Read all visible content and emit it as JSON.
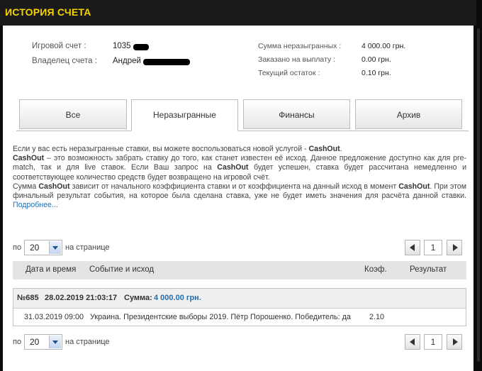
{
  "title": "ИСТОРИЯ СЧЕТА",
  "account": {
    "account_label": "Игровой счет :",
    "account_value": "1035",
    "owner_label": "Владелец счета :",
    "owner_value": "Андрей"
  },
  "summary": {
    "unplayed_label": "Сумма неразыгранных :",
    "unplayed_value": "4 000.00 грн.",
    "payout_label": "Заказано на выплату :",
    "payout_value": "0.00 грн.",
    "balance_label": "Текущий остаток :",
    "balance_value": "0.10 грн."
  },
  "tabs": [
    {
      "label": "Все",
      "active": false
    },
    {
      "label": "Неразыгранные",
      "active": true
    },
    {
      "label": "Финансы",
      "active": false
    },
    {
      "label": "Архив",
      "active": false
    }
  ],
  "info": {
    "p1_a": "Если у вас есть неразыгранные ставки, вы можете воспользоваться новой услугой - ",
    "p1_b": "CashOut",
    "p1_c": ".",
    "p2_a": "CashOut",
    "p2_b": " – это возможность забрать ставку до того, как станет известен её исход. Данное предложение доступно как для pre-match, так и для live ставок. Если Ваш запрос на ",
    "p2_c": "CashOut",
    "p2_d": " будет успешен, ставка будет рассчитана немедленно и соответствующее количество средств будет возвращено на игровой счёт.",
    "p3_a": "Сумма ",
    "p3_b": "CashOut",
    "p3_c": " зависит от начального коэффициента ставки и от коэффициента на данный исход в момент ",
    "p3_d": "CashOut",
    "p3_e": ". При этом финальный результат события, на которое была сделана ставка, уже не будет иметь значения для расчёта данной ставки. ",
    "more": "Подробнее..."
  },
  "pager": {
    "prefix": "по",
    "per_page": "20",
    "suffix": "на странице",
    "page": "1"
  },
  "table": {
    "headers": {
      "datetime": "Дата и время",
      "event": "Событие и исход",
      "coef": "Коэф.",
      "result": "Результат"
    },
    "group": {
      "number": "№685",
      "datetime": "28.02.2019 21:03:17",
      "sum_label": "Сумма:",
      "sum_value": "4 000.00 грн."
    },
    "row": {
      "datetime": "31.03.2019 09:00",
      "event": "Украина. Президентские выборы 2019. Пётр Порошенко. Победитель: да",
      "coef": "2.10",
      "result": ""
    }
  }
}
